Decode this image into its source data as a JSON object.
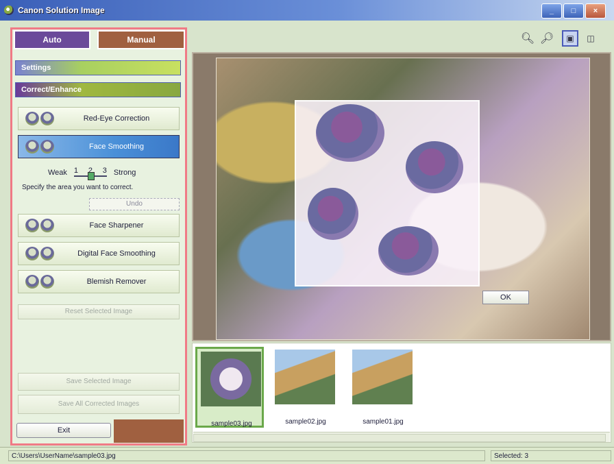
{
  "window": {
    "title": "Canon Solution Image"
  },
  "mode_tabs": {
    "auto": "Auto",
    "manual": "Manual"
  },
  "sections": {
    "settings": "Settings",
    "correct_enhance": "Correct/Enhance"
  },
  "tools": {
    "red_eye": "Red-Eye Correction",
    "face_smoothing": "Face Smoothing",
    "face_sharpener": "Face Sharpener",
    "digital_face_smoothing": "Digital Face Smoothing",
    "blemish_remover": "Blemish Remover"
  },
  "strength": {
    "weak": "Weak",
    "strong": "Strong",
    "ticks": [
      "1",
      "2",
      "3"
    ]
  },
  "hint": "Specify the area you want to correct.",
  "buttons": {
    "undo": "Undo",
    "reset": "Reset Selected Image",
    "save_selected": "Save Selected Image",
    "save_all": "Save All Corrected Images",
    "exit": "Exit",
    "ok": "OK"
  },
  "thumbnails": [
    {
      "name": "sample03.jpg",
      "selected": true
    },
    {
      "name": "sample02.jpg",
      "selected": false
    },
    {
      "name": "sample01.jpg",
      "selected": false
    }
  ],
  "status": {
    "path": "C:\\Users\\UserName\\sample03.jpg",
    "selected": "Selected: 3"
  },
  "colors": {
    "accent_border": "#f07a86",
    "auto_tab": "#6b4a9a",
    "manual_tab": "#a06040",
    "title_bar": "#3a5fb8"
  }
}
